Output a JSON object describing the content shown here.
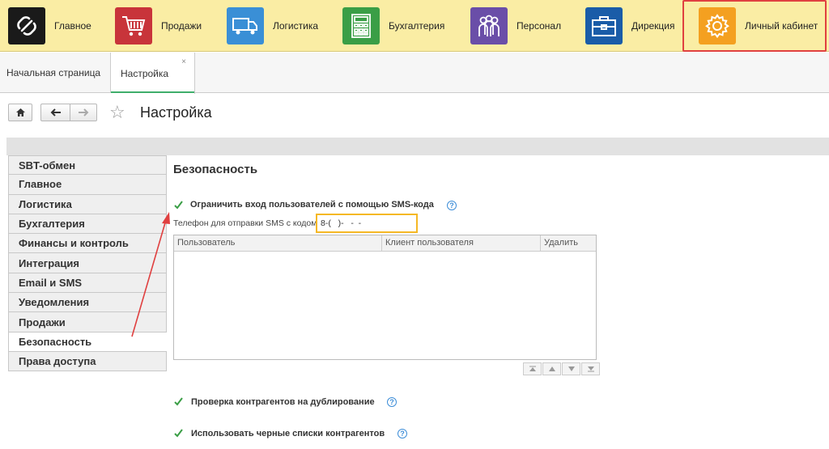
{
  "menu": [
    {
      "label": "Главное",
      "icon": "logo-icon",
      "color": "#1a1a1a"
    },
    {
      "label": "Продажи",
      "icon": "cart-icon",
      "color": "#c8343a"
    },
    {
      "label": "Логистика",
      "icon": "truck-icon",
      "color": "#3a8fd6"
    },
    {
      "label": "Бухгалтерия",
      "icon": "calculator-icon",
      "color": "#3a9e46"
    },
    {
      "label": "Персонал",
      "icon": "people-icon",
      "color": "#6a4ea8"
    },
    {
      "label": "Дирекция",
      "icon": "briefcase-icon",
      "color": "#1a5ca8"
    },
    {
      "label": "Личный кабинет",
      "icon": "gear-icon",
      "color": "#f4a020"
    }
  ],
  "tabs": {
    "home": "Начальная страница",
    "settings": "Настройка",
    "close": "×"
  },
  "header": {
    "title": "Настройка"
  },
  "sections": [
    "SBT-обмен",
    "Главное",
    "Логистика",
    "Бухгалтерия",
    "Финансы и контроль",
    "Интеграция",
    "Email и SMS",
    "Уведомления",
    "Продажи",
    "Безопасность",
    "Права доступа"
  ],
  "active_section": "Безопасность",
  "content": {
    "title": "Безопасность",
    "sms_checkbox_label": "Ограничить вход пользователей с помощью SMS-кода",
    "phone_label": "Телефон для отправки SMS с кодом:",
    "phone_value": "8-(   )-   -  -",
    "grid_columns": [
      "Пользователь",
      "Клиент пользователя",
      "Удалить"
    ],
    "dup_check_label": "Проверка контрагентов на дублирование",
    "blacklist_label": "Использовать черные списки контрагентов",
    "help": "?"
  },
  "colors": {
    "accent_green": "#3fae6b",
    "highlight_red": "#e04040",
    "highlight_yellow": "#f5b825",
    "menu_bg": "#faeda4"
  }
}
